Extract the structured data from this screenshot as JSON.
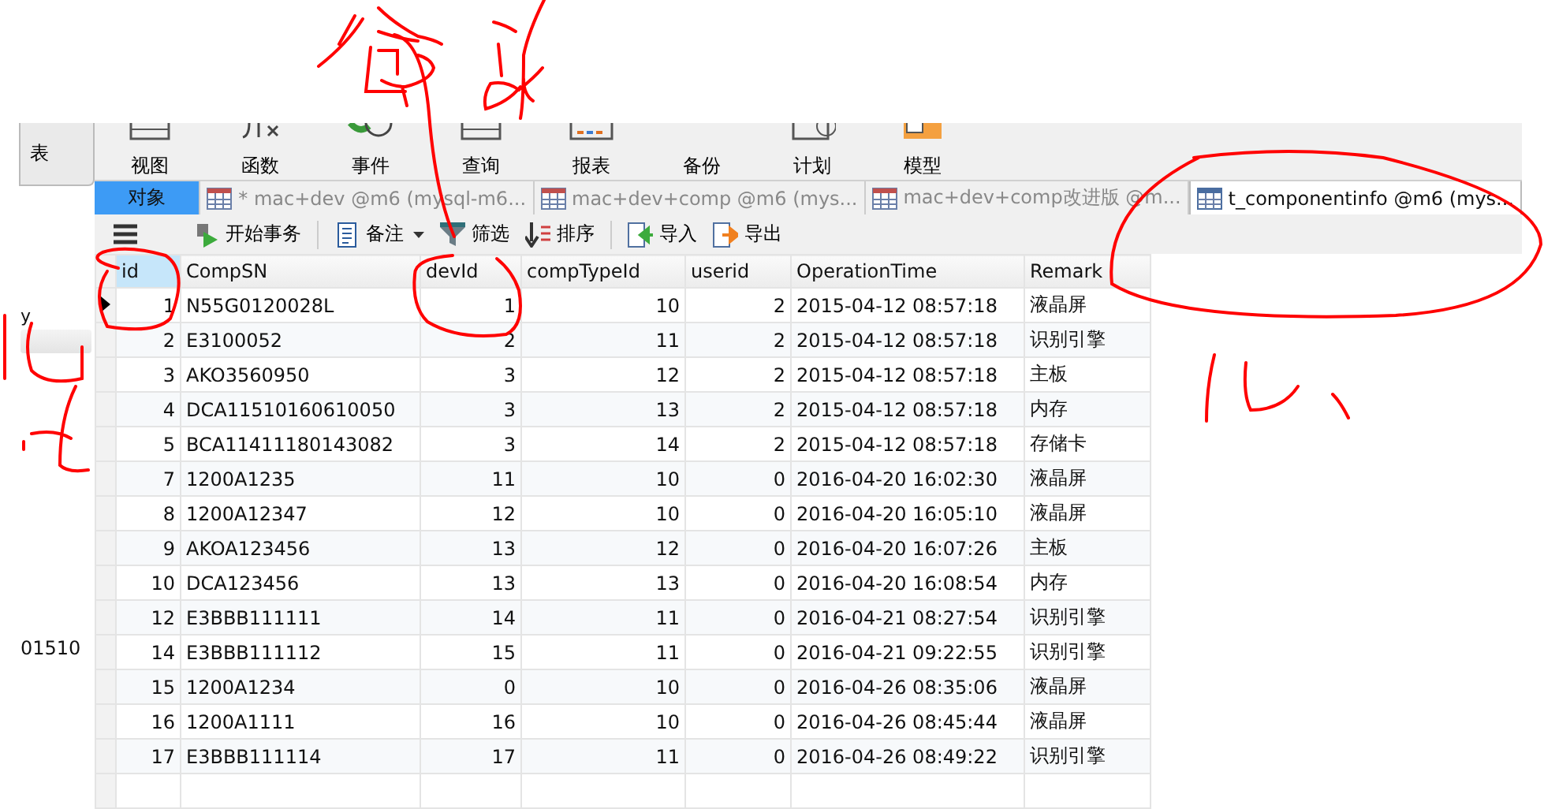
{
  "sidebar": {
    "button": "表",
    "texts": [
      "y",
      "01510"
    ]
  },
  "toolbar": [
    "视图",
    "函数",
    "事件",
    "查询",
    "报表",
    "备份",
    "计划",
    "模型"
  ],
  "tabs": [
    {
      "label": "对象",
      "kind": "objects",
      "selected": false
    },
    {
      "label": "* mac+dev @m6 (mysql-m6...",
      "kind": "table",
      "selected": false
    },
    {
      "label": "mac+dev+comp @m6 (mys...",
      "kind": "table",
      "selected": false
    },
    {
      "label": "mac+dev+comp改进版 @m...",
      "kind": "table",
      "selected": false
    },
    {
      "label": "t_componentinfo @m6 (mys...",
      "kind": "table",
      "selected": true
    }
  ],
  "actions": [
    "开始事务",
    "备注",
    "筛选",
    "排序",
    "导入",
    "导出"
  ],
  "table": {
    "columns": [
      "id",
      "CompSN",
      "devId",
      "compTypeId",
      "userid",
      "OperationTime",
      "Remark"
    ],
    "rows": [
      {
        "selected": true,
        "cells": [
          "1",
          "N55G0120028L",
          "1",
          "10",
          "2",
          "2015-04-12 08:57:18",
          "液晶屏"
        ]
      },
      {
        "selected": false,
        "cells": [
          "2",
          "E3100052",
          "2",
          "11",
          "2",
          "2015-04-12 08:57:18",
          "识别引擎"
        ]
      },
      {
        "selected": false,
        "cells": [
          "3",
          "AKO3560950",
          "3",
          "12",
          "2",
          "2015-04-12 08:57:18",
          "主板"
        ]
      },
      {
        "selected": false,
        "cells": [
          "4",
          "DCA11510160610050",
          "3",
          "13",
          "2",
          "2015-04-12 08:57:18",
          "内存"
        ]
      },
      {
        "selected": false,
        "cells": [
          "5",
          "BCA11411180143082",
          "3",
          "14",
          "2",
          "2015-04-12 08:57:18",
          "存储卡"
        ]
      },
      {
        "selected": false,
        "cells": [
          "7",
          "1200A1235",
          "11",
          "10",
          "0",
          "2016-04-20 16:02:30",
          "液晶屏"
        ]
      },
      {
        "selected": false,
        "cells": [
          "8",
          "1200A12347",
          "12",
          "10",
          "0",
          "2016-04-20 16:05:10",
          "液晶屏"
        ]
      },
      {
        "selected": false,
        "cells": [
          "9",
          "AKOA123456",
          "13",
          "12",
          "0",
          "2016-04-20 16:07:26",
          "主板"
        ]
      },
      {
        "selected": false,
        "cells": [
          "10",
          "DCA123456",
          "13",
          "13",
          "0",
          "2016-04-20 16:08:54",
          "内存"
        ]
      },
      {
        "selected": false,
        "cells": [
          "12",
          "E3BBB111111",
          "14",
          "11",
          "0",
          "2016-04-21 08:27:54",
          "识别引擎"
        ]
      },
      {
        "selected": false,
        "cells": [
          "14",
          "E3BBB111112",
          "15",
          "11",
          "0",
          "2016-04-21 09:22:55",
          "识别引擎"
        ]
      },
      {
        "selected": false,
        "cells": [
          "15",
          "1200A1234",
          "0",
          "10",
          "0",
          "2016-04-26 08:35:06",
          "液晶屏"
        ]
      },
      {
        "selected": false,
        "cells": [
          "16",
          "1200A1111",
          "16",
          "10",
          "0",
          "2016-04-26 08:45:44",
          "液晶屏"
        ]
      },
      {
        "selected": false,
        "cells": [
          "17",
          "E3BBB111114",
          "17",
          "11",
          "0",
          "2016-04-26 08:49:22",
          "识别引擎"
        ]
      }
    ]
  }
}
